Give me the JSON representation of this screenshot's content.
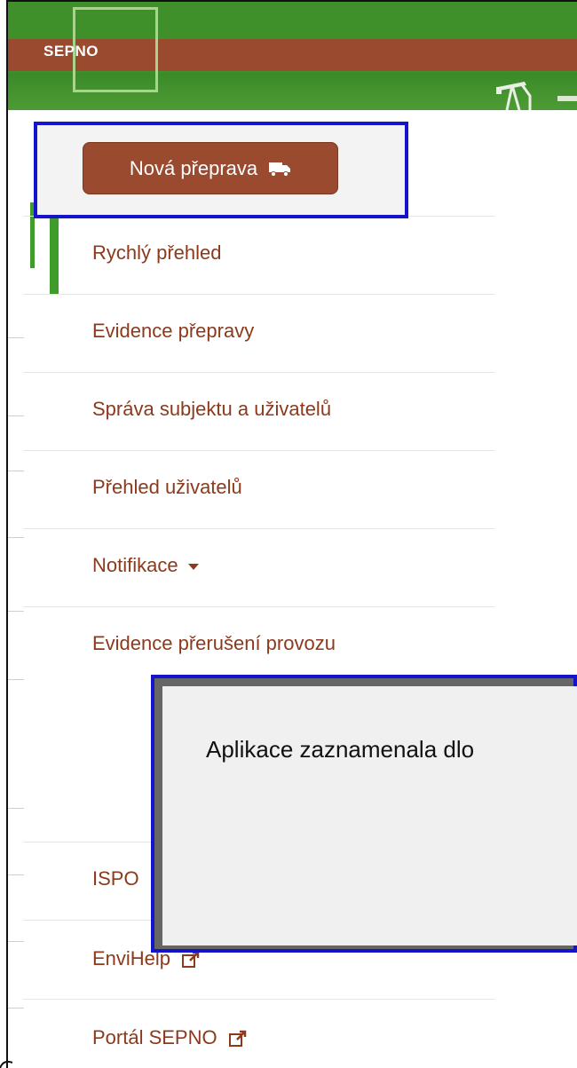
{
  "header": {
    "logo_text": "SEPNO",
    "colors": {
      "banner_green": "#3f8f2b",
      "banner_brown": "#9a4a2e",
      "logo_frame": "#a8d58c"
    }
  },
  "new_transport_button": {
    "label": "Nová přeprava",
    "icon": "truck-icon"
  },
  "sidebar": {
    "items": [
      {
        "label": "Rychlý přehled",
        "active": true
      },
      {
        "label": "Evidence přepravy"
      },
      {
        "label": "Správa subjektu a uživatelů"
      },
      {
        "label": "Přehled uživatelů"
      },
      {
        "label": "Notifikace",
        "icon": "caret-down-icon"
      },
      {
        "label": "Evidence přerušení provozu"
      },
      {
        "label": "ISPO"
      },
      {
        "label": "EnviHelp",
        "icon": "external-link-icon"
      },
      {
        "label": "Portál SEPNO",
        "icon": "external-link-icon"
      }
    ],
    "colors": {
      "link": "#8b3a1c",
      "active_bar": "#3f9b2a"
    }
  },
  "dialog": {
    "message": "Aplikace zaznamenala dlo"
  },
  "highlight_color": "#1414c8"
}
